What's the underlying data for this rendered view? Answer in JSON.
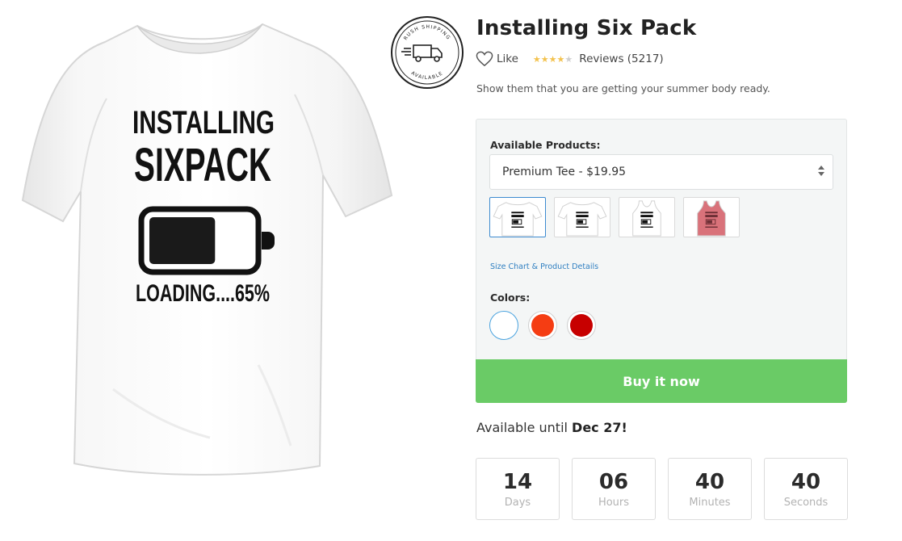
{
  "product": {
    "title": "Installing Six Pack",
    "like_label": "Like",
    "rating": 4,
    "rating_max": 5,
    "reviews_label": "Reviews (5217)",
    "tagline": "Show them that you are getting your summer body ready.",
    "print_lines": [
      "INSTALLING",
      "SIXPACK",
      "LOADING....65%"
    ],
    "battery_level_percent": 65
  },
  "badge": {
    "top_text": "RUSH SHIPPING",
    "bottom_text": "AVAILABLE",
    "icon": "delivery-truck-icon"
  },
  "panel": {
    "products_label": "Available Products:",
    "selected_product": "Premium Tee - $19.95",
    "thumbnails": [
      {
        "name": "Premium Tee",
        "color": "#ffffff",
        "selected": true
      },
      {
        "name": "Tee",
        "color": "#ffffff",
        "selected": false
      },
      {
        "name": "Tank Top",
        "color": "#ffffff",
        "selected": false
      },
      {
        "name": "Tank Top",
        "color": "#d9727a",
        "selected": false
      }
    ],
    "size_chart_link": "Size Chart & Product Details",
    "colors_label": "Colors:",
    "colors": [
      {
        "hex": "#ffffff",
        "selected": true
      },
      {
        "hex": "#f53d13",
        "selected": false
      },
      {
        "hex": "#c70000",
        "selected": false
      }
    ],
    "buy_label": "Buy it now",
    "buy_color": "#6acb66"
  },
  "availability": {
    "prefix": "Available until ",
    "date": "Dec 27!"
  },
  "countdown": [
    {
      "value": "14",
      "unit": "Days"
    },
    {
      "value": "06",
      "unit": "Hours"
    },
    {
      "value": "40",
      "unit": "Minutes"
    },
    {
      "value": "40",
      "unit": "Seconds"
    }
  ]
}
